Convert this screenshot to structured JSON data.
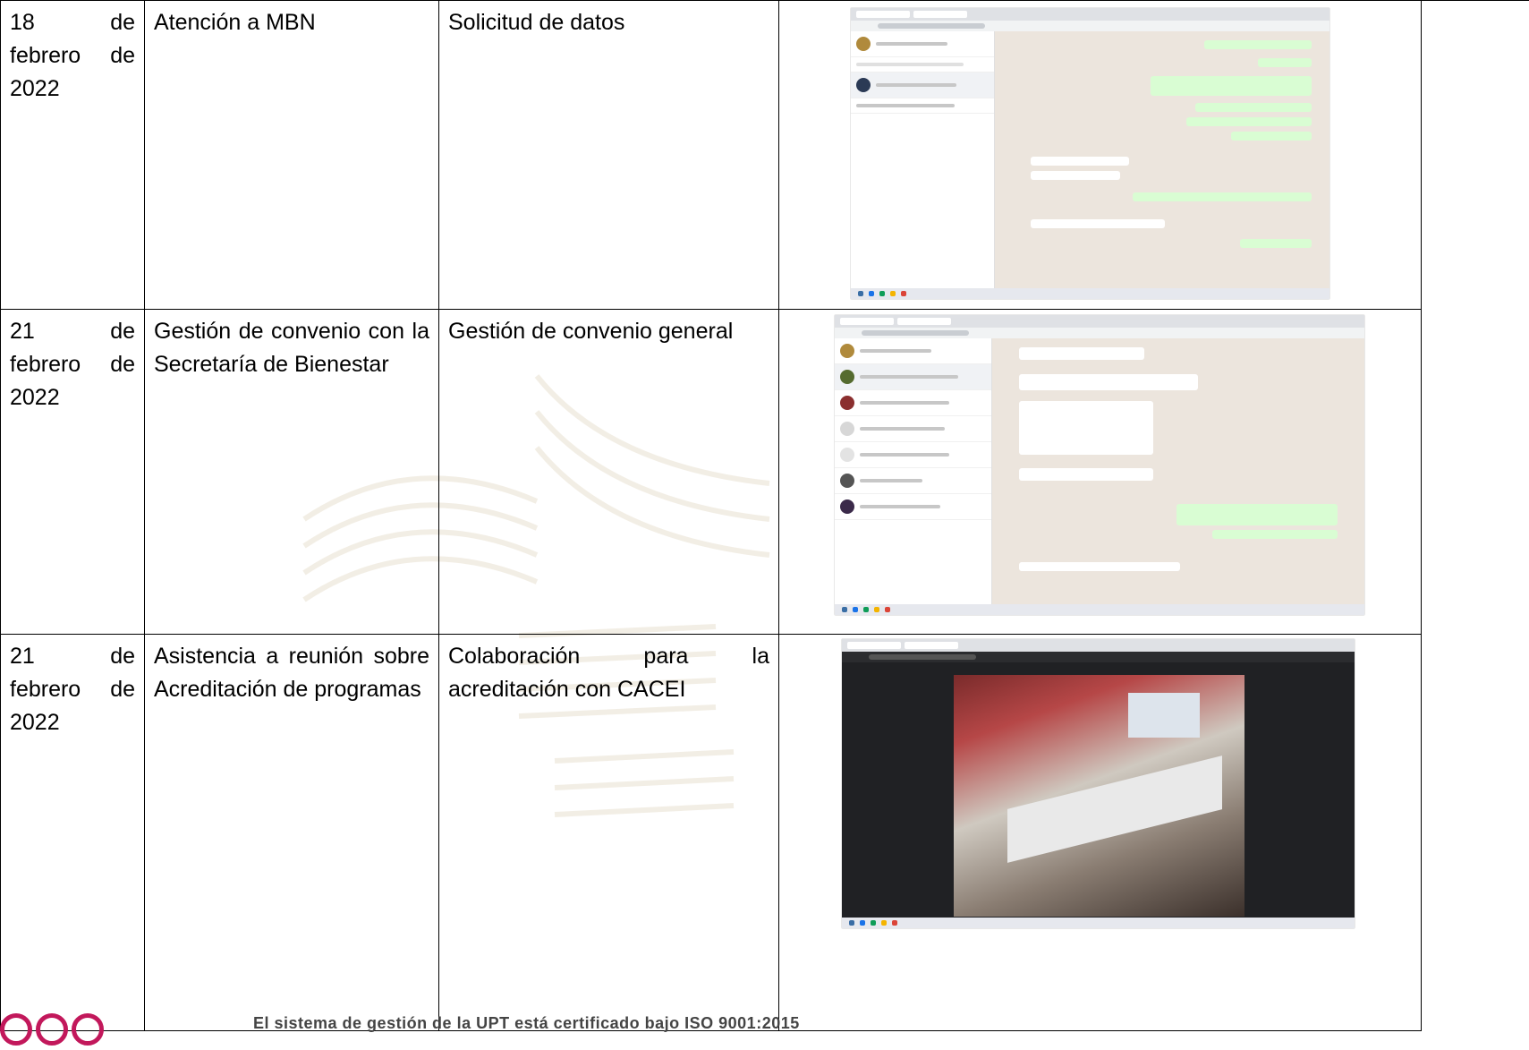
{
  "rows": [
    {
      "date": "18 de febrero de 2022",
      "activity": "Atención a MBN",
      "result": "Solicitud de datos",
      "evidence": "whatsapp-chat-screenshot"
    },
    {
      "date": "21 de febrero de 2022",
      "activity": "Gestión de convenio con la Secretaría de Bienestar",
      "result": "Gestión de convenio general",
      "evidence": "whatsapp-chat-screenshot"
    },
    {
      "date": "21 de febrero de 2022",
      "activity": "Asistencia a reunión sobre Acreditación de programas",
      "result": "Colaboración para la acreditación con CACEI",
      "evidence": "video-meeting-screenshot"
    }
  ],
  "footer": {
    "text": "El sistema de gestión de la UPT está certificado bajo ISO 9001:2015"
  },
  "colors": {
    "footer_logo": "#c2185b",
    "whatsapp_bg": "#ece5dd",
    "whatsapp_out_bubble": "#d9fdd3"
  }
}
